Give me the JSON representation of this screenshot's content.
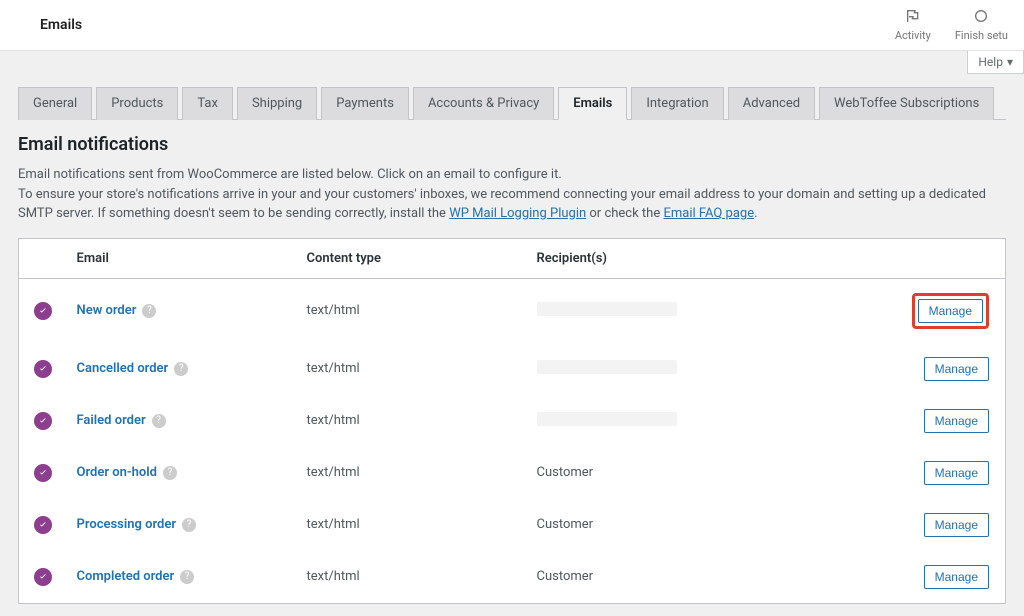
{
  "topbar": {
    "title": "Emails",
    "activity": "Activity",
    "finish": "Finish setu"
  },
  "help": {
    "label": "Help"
  },
  "tabs": [
    {
      "label": "General",
      "active": false
    },
    {
      "label": "Products",
      "active": false
    },
    {
      "label": "Tax",
      "active": false
    },
    {
      "label": "Shipping",
      "active": false
    },
    {
      "label": "Payments",
      "active": false
    },
    {
      "label": "Accounts & Privacy",
      "active": false
    },
    {
      "label": "Emails",
      "active": true
    },
    {
      "label": "Integration",
      "active": false
    },
    {
      "label": "Advanced",
      "active": false
    },
    {
      "label": "WebToffee Subscriptions",
      "active": false
    }
  ],
  "section": {
    "title": "Email notifications",
    "desc_line1": "Email notifications sent from WooCommerce are listed below. Click on an email to configure it.",
    "desc_line2a": "To ensure your store's notifications arrive in your and your customers' inboxes, we recommend connecting your email address to your domain and setting up a dedicated SMTP server. If something doesn't seem to be sending correctly, install the ",
    "desc_link1": "WP Mail Logging Plugin",
    "desc_line2b": " or check the ",
    "desc_link2": "Email FAQ page",
    "desc_line2c": "."
  },
  "table": {
    "headers": {
      "email": "Email",
      "content": "Content type",
      "recipient": "Recipient(s)"
    },
    "manage_label": "Manage",
    "rows": [
      {
        "name": "New order",
        "content": "text/html",
        "recipient": "",
        "redacted": true,
        "highlight": true
      },
      {
        "name": "Cancelled order",
        "content": "text/html",
        "recipient": "",
        "redacted": true,
        "highlight": false
      },
      {
        "name": "Failed order",
        "content": "text/html",
        "recipient": "",
        "redacted": true,
        "highlight": false
      },
      {
        "name": "Order on-hold",
        "content": "text/html",
        "recipient": "Customer",
        "redacted": false,
        "highlight": false
      },
      {
        "name": "Processing order",
        "content": "text/html",
        "recipient": "Customer",
        "redacted": false,
        "highlight": false
      },
      {
        "name": "Completed order",
        "content": "text/html",
        "recipient": "Customer",
        "redacted": false,
        "highlight": false
      }
    ]
  }
}
